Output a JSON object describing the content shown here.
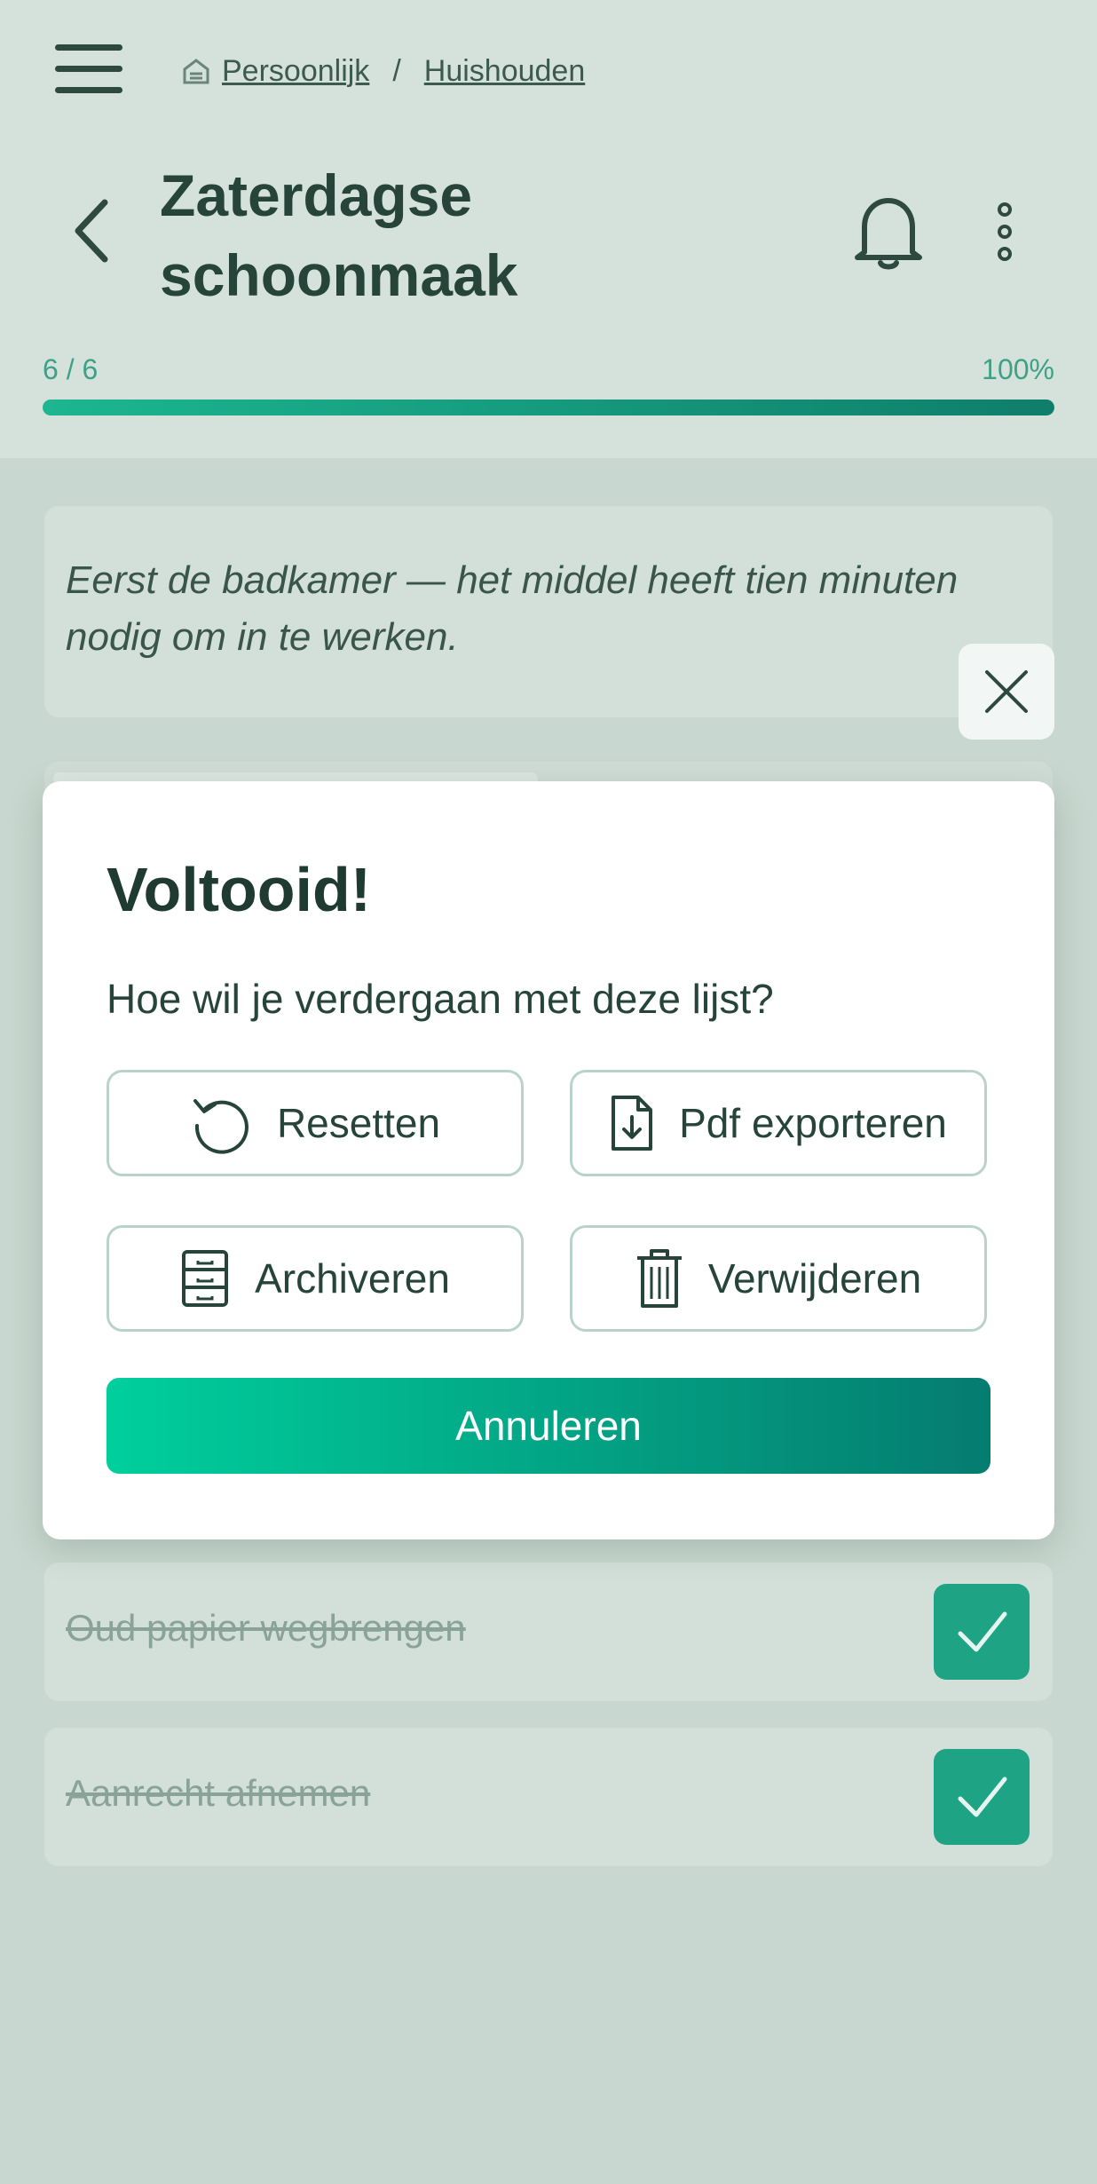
{
  "breadcrumb": {
    "items": [
      "Persoonlijk",
      "Huishouden"
    ],
    "separator": "/"
  },
  "header": {
    "title": "Zaterdagse schoonmaak"
  },
  "progress": {
    "count_label": "6 / 6",
    "percent_label": "100%",
    "value": 1.0
  },
  "note": {
    "text": "Eerst de badkamer — het middel heeft tien minuten nodig om in te werken."
  },
  "tasks": [
    {
      "label": "Oud papier wegbrengen",
      "checked": true
    },
    {
      "label": "Aanrecht afnemen",
      "checked": true
    }
  ],
  "modal": {
    "title": "Voltooid!",
    "question": "Hoe wil je verdergaan met deze lijst?",
    "reset_label": "Resetten",
    "export_label": "Pdf exporteren",
    "archive_label": "Archiveren",
    "delete_label": "Verwijderen",
    "cancel_label": "Annuleren"
  },
  "icons": [
    "menu-icon",
    "home-icon",
    "back-arrow-icon",
    "bell-icon",
    "more-vertical-icon",
    "close-icon",
    "reset-icon",
    "pdf-export-icon",
    "archive-icon",
    "trash-icon",
    "checkmark-icon"
  ],
  "colors": {
    "accent": "#00cf9c",
    "accent_dark": "#057c70",
    "text": "#1f3a30",
    "check": "#1ea485"
  }
}
